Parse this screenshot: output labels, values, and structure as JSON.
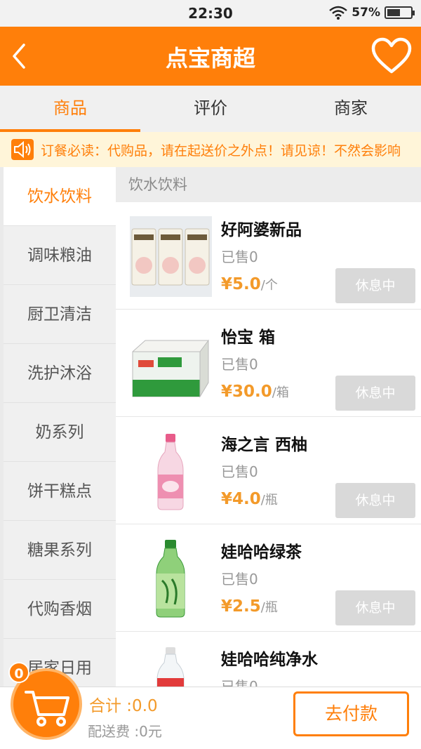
{
  "status_bar": {
    "time": "22:30",
    "battery": "57%",
    "battery_level": 0.57
  },
  "header": {
    "title": "点宝商超",
    "back_icon": "chevron-left-icon",
    "favorite_icon": "heart-outline-icon"
  },
  "colors": {
    "brand": "#ff7f0a",
    "price": "#f39a2a",
    "disabled": "#d9d9d9"
  },
  "tabs": [
    {
      "label": "商品",
      "active": true
    },
    {
      "label": "评价",
      "active": false
    },
    {
      "label": "商家",
      "active": false
    }
  ],
  "notice": {
    "icon": "speaker-icon",
    "text": "订餐必读：代购品，请在起送价之外点！请见谅！不然会影响"
  },
  "sidebar": {
    "items": [
      {
        "label": "饮水饮料",
        "active": true
      },
      {
        "label": "调味粮油"
      },
      {
        "label": "厨卫清洁"
      },
      {
        "label": "洗护沐浴"
      },
      {
        "label": "奶系列"
      },
      {
        "label": "饼干糕点"
      },
      {
        "label": "糖果系列"
      },
      {
        "label": "代购香烟"
      },
      {
        "label": "居家日用"
      }
    ]
  },
  "section": {
    "title": "饮水饮料"
  },
  "products": [
    {
      "name": "好阿婆新品",
      "sold": "已售0",
      "price": "¥5.0",
      "unit": "/个",
      "button": "休息中",
      "image": "pastry-pack-image"
    },
    {
      "name": "怡宝  箱",
      "sold": "已售0",
      "price": "¥30.0",
      "unit": "/箱",
      "button": "休息中",
      "image": "water-case-image"
    },
    {
      "name": "海之言  西柚",
      "sold": "已售0",
      "price": "¥4.0",
      "unit": "/瓶",
      "button": "休息中",
      "image": "pink-bottle-image"
    },
    {
      "name": "娃哈哈绿茶",
      "sold": "已售0",
      "price": "¥2.5",
      "unit": "/瓶",
      "button": "休息中",
      "image": "green-tea-bottle-image"
    },
    {
      "name": "娃哈哈纯净水",
      "sold": "已售0",
      "price": "",
      "unit": "",
      "button": "",
      "image": "water-bottle-image"
    }
  ],
  "cart": {
    "count": "0",
    "total": "合计 :0.0",
    "delivery_fee": "配送费 :0元",
    "pay_label": "去付款",
    "icon": "cart-icon"
  }
}
